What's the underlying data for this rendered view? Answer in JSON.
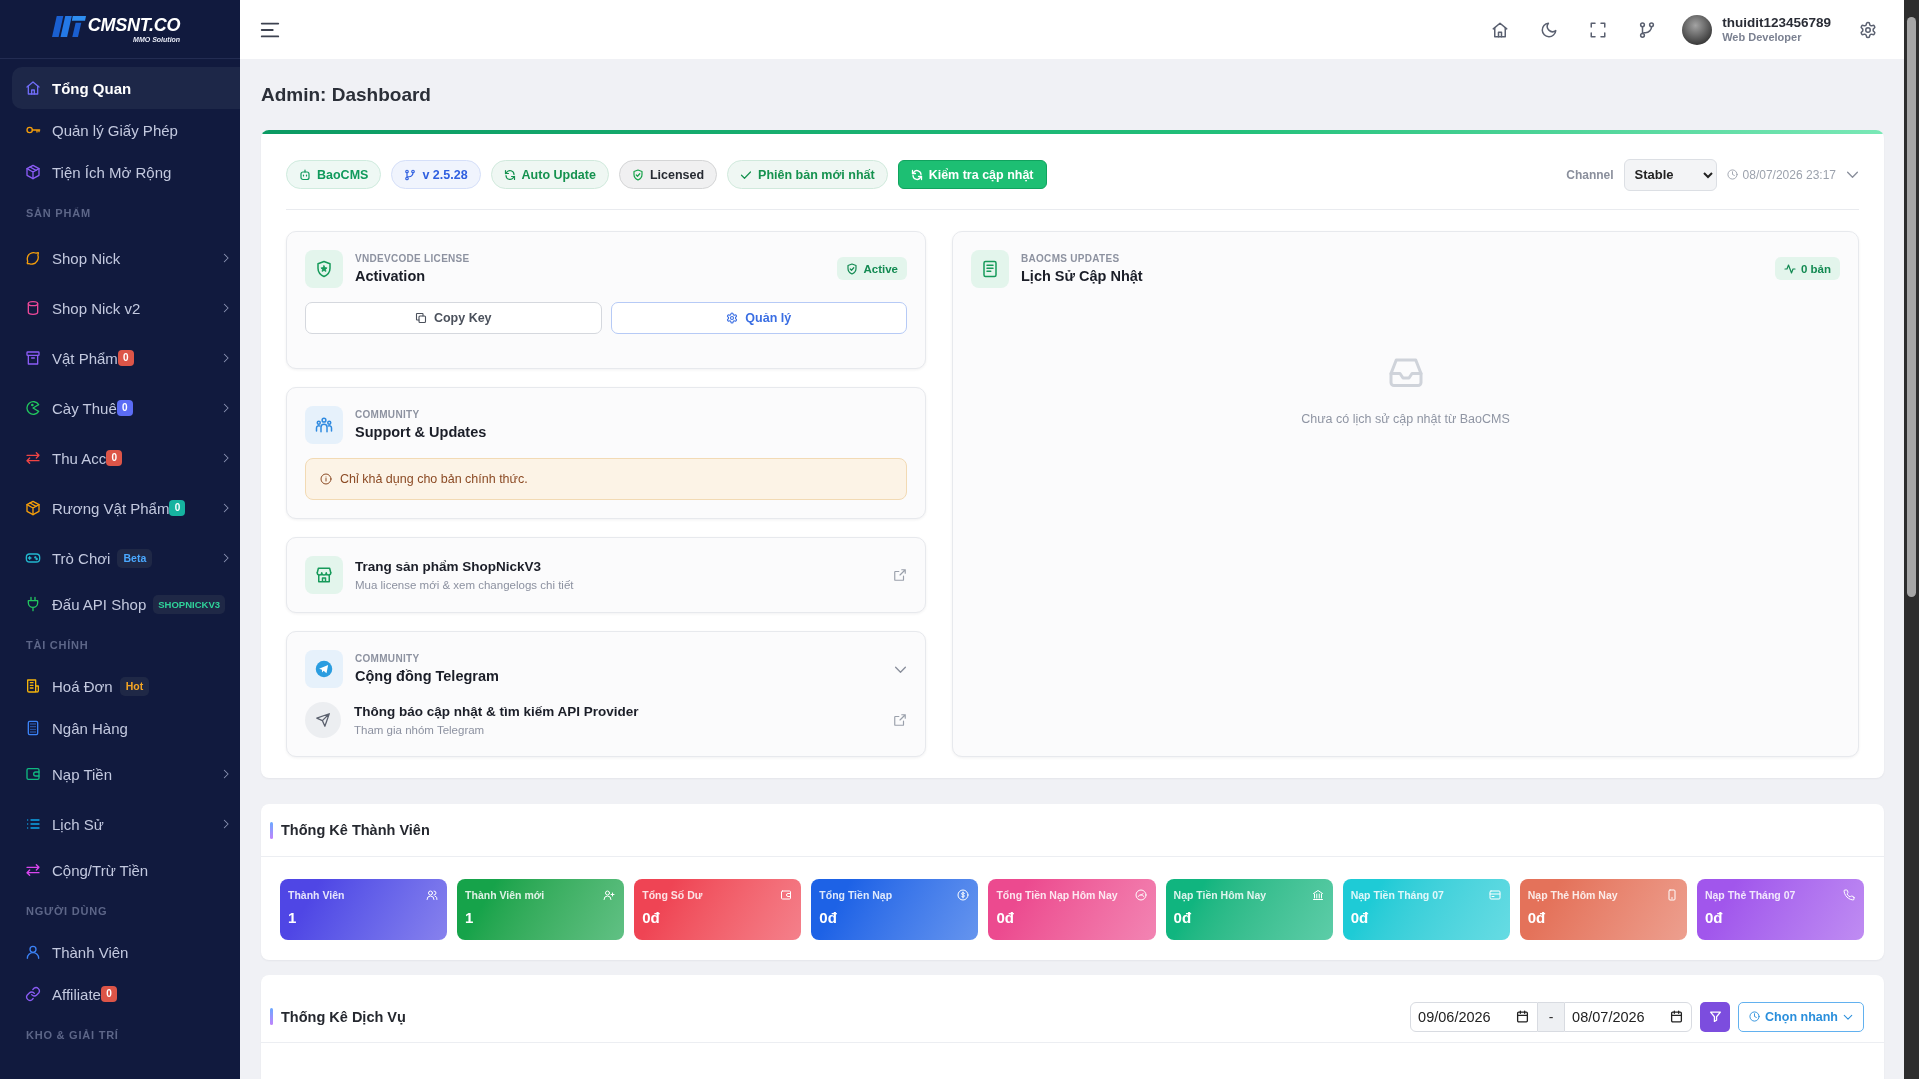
{
  "sidebar": {
    "logo": {
      "text": "CMSNT.CO",
      "tagline": "MMO Solution"
    },
    "sections": [
      {
        "items": [
          {
            "label": "Tổng Quan",
            "selected": true,
            "expandable": false
          },
          {
            "label": "Quản lý Giấy Phép",
            "selected": false,
            "expandable": false
          },
          {
            "label": "Tiện Ích Mở Rộng",
            "selected": false,
            "expandable": false
          }
        ]
      },
      {
        "heading": "SẢN PHẨM",
        "items": [
          {
            "label": "Shop Nick",
            "selected": false,
            "expandable": true
          },
          {
            "label": "Shop Nick v2",
            "selected": false,
            "expandable": true
          },
          {
            "label": "Vật Phẩm",
            "selected": false,
            "expandable": true,
            "badge": {
              "kind": "count",
              "text": "0",
              "color": "#dd5548"
            }
          },
          {
            "label": "Cày Thuê",
            "selected": false,
            "expandable": true,
            "badge": {
              "kind": "count",
              "text": "0",
              "color": "#5b6cf5"
            }
          },
          {
            "label": "Thu Acc",
            "selected": false,
            "expandable": true,
            "badge": {
              "kind": "count",
              "text": "0",
              "color": "#dd5548"
            }
          },
          {
            "label": "Rương Vật Phẩm",
            "selected": false,
            "expandable": true,
            "badge": {
              "kind": "count",
              "text": "0",
              "color": "#16b3a0"
            }
          },
          {
            "label": "Trò Chơi",
            "selected": false,
            "expandable": true,
            "badge": {
              "kind": "tag",
              "text": "Beta",
              "color": "#4aa8ff"
            }
          },
          {
            "label": "Đấu API Shop",
            "selected": false,
            "expandable": false,
            "badge": {
              "kind": "tag",
              "text": "SHOPNICKV3",
              "color": "#2fd39a"
            }
          }
        ]
      },
      {
        "heading": "TÀI CHÍNH",
        "items": [
          {
            "label": "Hoá Đơn",
            "selected": false,
            "expandable": false,
            "badge": {
              "kind": "tag",
              "text": "Hot",
              "color": "#f5a623"
            }
          },
          {
            "label": "Ngân Hàng",
            "selected": false,
            "expandable": false
          },
          {
            "label": "Nạp Tiền",
            "selected": false,
            "expandable": true
          },
          {
            "label": "Lịch Sử",
            "selected": false,
            "expandable": true
          },
          {
            "label": "Cộng/Trừ Tiền",
            "selected": false,
            "expandable": false
          }
        ]
      },
      {
        "heading": "NGƯỜI DÙNG",
        "items": [
          {
            "label": "Thành Viên",
            "selected": false,
            "expandable": false
          },
          {
            "label": "Affiliate",
            "selected": false,
            "expandable": false,
            "badge": {
              "kind": "count",
              "text": "0",
              "color": "#dd5548"
            }
          }
        ]
      },
      {
        "heading": "KHO & GIẢI TRÍ"
      }
    ]
  },
  "topbar": {
    "user": {
      "name": "thuidit123456789",
      "role": "Web Developer"
    }
  },
  "page_title": "Admin: Dashboard",
  "update_panel": {
    "badges": [
      {
        "text": "BaoCMS",
        "color": "#109a5c"
      },
      {
        "text": "v 2.5.28",
        "color": "#2f5fe0"
      },
      {
        "text": "Auto Update",
        "color": "#15924f"
      },
      {
        "text": "Licensed",
        "color": "#272b33"
      },
      {
        "text": "Phiên bản mới nhất",
        "color": "#15924f"
      }
    ],
    "check_button": "Kiểm tra cập nhật",
    "channel_label": "Channel",
    "channel_value": "Stable",
    "timestamp": "08/07/2026 23:17",
    "license_card": {
      "eyebrow": "VNDEVCODE LICENSE",
      "title": "Activation",
      "status": "Active",
      "buttons": [
        {
          "label": "Copy Key",
          "kind": "neutral"
        },
        {
          "label": "Quản lý",
          "kind": "accent"
        }
      ]
    },
    "support_card": {
      "eyebrow": "COMMUNITY",
      "title": "Support & Updates",
      "notice": "Chỉ khả dụng cho bản chính thức."
    },
    "product_card": {
      "title": "Trang sản phẩm ShopNickV3",
      "subtitle": "Mua license mới & xem changelogs chi tiết"
    },
    "telegram_card": {
      "eyebrow": "COMMUNITY",
      "title": "Cộng đồng Telegram",
      "expanded": true,
      "link": {
        "title": "Thông báo cập nhật & tìm kiếm API Provider",
        "subtitle": "Tham gia nhóm Telegram"
      }
    },
    "updates_card": {
      "eyebrow": "BAOCMS UPDATES",
      "title": "Lịch Sử Cập Nhật",
      "count": "0 bản",
      "empty_text": "Chưa có lịch sử cập nhật từ BaoCMS"
    }
  },
  "member_stats": {
    "title": "Thống Kê Thành Viên",
    "tiles": [
      {
        "label": "Thành Viên",
        "value": "1",
        "color": "#4f46e5"
      },
      {
        "label": "Thành Viên mới",
        "value": "1",
        "color": "#16a34a"
      },
      {
        "label": "Tổng Số Dư",
        "value": "0đ",
        "color": "#ef4454"
      },
      {
        "label": "Tổng Tiền Nạp",
        "value": "0đ",
        "color": "#1d62e6"
      },
      {
        "label": "Tổng Tiền Nạp Hôm Nay",
        "value": "0đ",
        "color": "#ec4a8f"
      },
      {
        "label": "Nạp Tiền Hôm Nay",
        "value": "0đ",
        "color": "#10b57f"
      },
      {
        "label": "Nạp Tiền Tháng 07",
        "value": "0đ",
        "color": "#1ecbd6"
      },
      {
        "label": "Nạp Thẻ Hôm Nay",
        "value": "0đ",
        "color": "#e4725a"
      },
      {
        "label": "Nạp Thẻ Tháng 07",
        "value": "0đ",
        "color": "#a156ec"
      }
    ]
  },
  "service_stats": {
    "title": "Thống Kê Dịch Vụ",
    "date_from": "09/06/2026",
    "separator": "-",
    "date_to": "08/07/2026",
    "quick_range": "Chọn nhanh"
  }
}
